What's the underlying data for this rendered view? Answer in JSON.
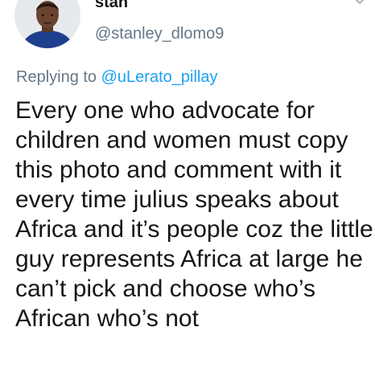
{
  "user": {
    "display_name": "stan",
    "handle": "@stanley_dlomo9"
  },
  "reply": {
    "prefix": "Replying to ",
    "mention": "@uLerato_pillay"
  },
  "tweet": {
    "text": "Every one who advocate for children and women must copy this photo and comment with it every time julius speaks about Africa and it’s people coz the little guy represents Africa at large he can’t pick and choose who’s African who’s not"
  },
  "icons": {
    "menu": "chevron-down-icon",
    "avatar": "profile-photo"
  },
  "colors": {
    "text": "#14171a",
    "secondary": "#657786",
    "link": "#1da1f2"
  }
}
